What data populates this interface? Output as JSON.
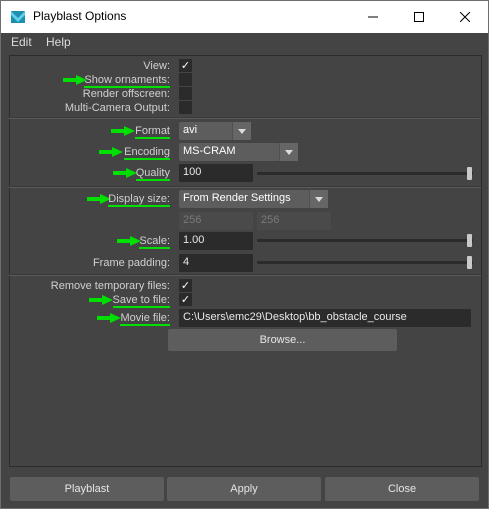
{
  "window": {
    "title": "Playblast Options",
    "controls": {
      "minimize_icon": "minimize-icon",
      "maximize_icon": "maximize-icon",
      "close_icon": "close-icon"
    }
  },
  "menu": [
    "Edit",
    "Help"
  ],
  "accent_color": "#00e000",
  "view": {
    "view_label": "View:",
    "view_checked": true,
    "ornaments_label": "Show ornaments:",
    "ornaments_checked": false,
    "offscreen_label": "Render offscreen:",
    "offscreen_checked": false,
    "multicam_label": "Multi-Camera Output:",
    "multicam_checked": false
  },
  "format": {
    "format_label": "Format",
    "format_value": "avi",
    "encoding_label": "Encoding",
    "encoding_value": "MS-CRAM",
    "quality_label": "Quality",
    "quality_value": "100",
    "quality_fraction": 1.0
  },
  "display": {
    "size_label": "Display size:",
    "size_value": "From Render Settings",
    "width_value": "256",
    "height_value": "256",
    "scale_label": "Scale:",
    "scale_value": "1.00",
    "scale_fraction": 1.0,
    "padding_label": "Frame padding:",
    "padding_value": "4",
    "padding_fraction": 1.0
  },
  "files": {
    "remove_temp_label": "Remove temporary files:",
    "remove_temp_checked": true,
    "save_to_file_label": "Save to file:",
    "save_to_file_checked": true,
    "movie_file_label": "Movie file:",
    "movie_file_value": "C:\\Users\\emc29\\Desktop\\bb_obstacle_course",
    "browse_label": "Browse..."
  },
  "buttons": {
    "playblast": "Playblast",
    "apply": "Apply",
    "close": "Close"
  },
  "check_glyph": "✓"
}
